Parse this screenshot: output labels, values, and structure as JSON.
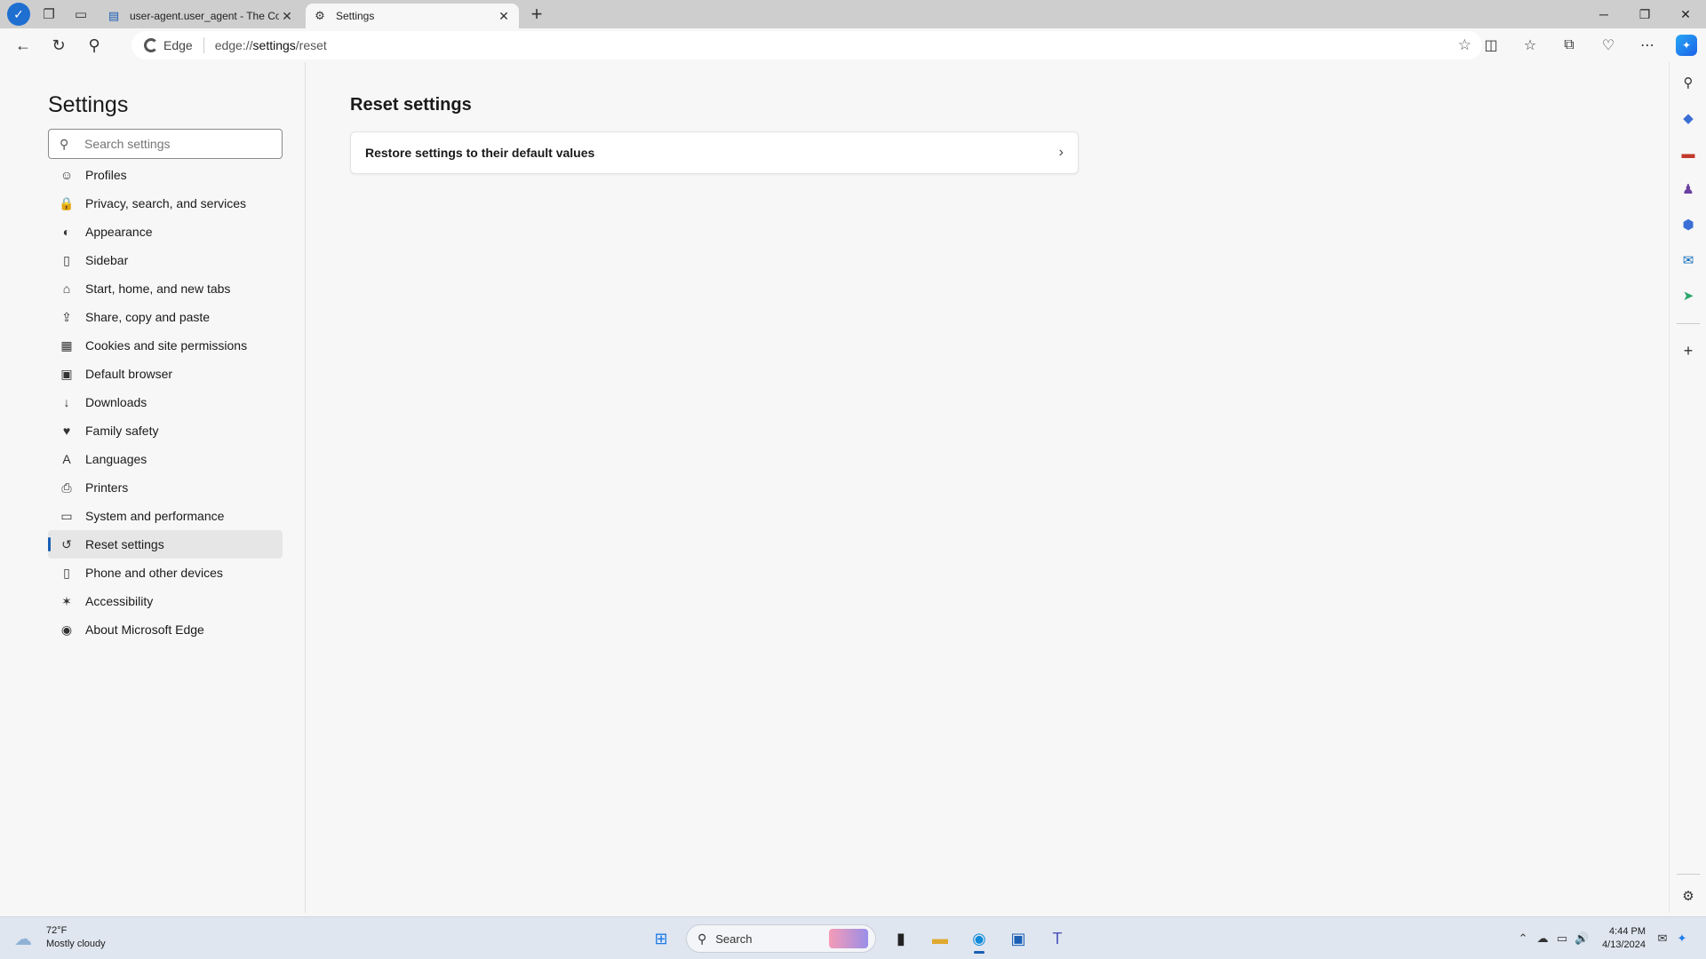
{
  "browser": {
    "tabs": [
      {
        "title": "user-agent.user_agent - The Coll",
        "active": false
      },
      {
        "title": "Settings",
        "active": true
      }
    ],
    "edge_chip": "Edge",
    "url_prefix": "edge://",
    "url_path": "settings",
    "url_suffix": "/reset"
  },
  "settings": {
    "title": "Settings",
    "search_placeholder": "Search settings",
    "nav": [
      {
        "label": "Profiles",
        "icon": "profile-icon",
        "glyph": "☺"
      },
      {
        "label": "Privacy, search, and services",
        "icon": "lock-icon",
        "glyph": "🔒"
      },
      {
        "label": "Appearance",
        "icon": "appearance-icon",
        "glyph": "◐"
      },
      {
        "label": "Sidebar",
        "icon": "sidebar-icon",
        "glyph": "▯"
      },
      {
        "label": "Start, home, and new tabs",
        "icon": "home-icon",
        "glyph": "⌂"
      },
      {
        "label": "Share, copy and paste",
        "icon": "share-icon",
        "glyph": "⇪"
      },
      {
        "label": "Cookies and site permissions",
        "icon": "cookies-icon",
        "glyph": "▦"
      },
      {
        "label": "Default browser",
        "icon": "default-browser-icon",
        "glyph": "▣"
      },
      {
        "label": "Downloads",
        "icon": "download-icon",
        "glyph": "↓"
      },
      {
        "label": "Family safety",
        "icon": "family-icon",
        "glyph": "♥"
      },
      {
        "label": "Languages",
        "icon": "languages-icon",
        "glyph": "A"
      },
      {
        "label": "Printers",
        "icon": "printer-icon",
        "glyph": "⎙"
      },
      {
        "label": "System and performance",
        "icon": "system-icon",
        "glyph": "▭"
      },
      {
        "label": "Reset settings",
        "icon": "reset-icon",
        "glyph": "↺",
        "active": true
      },
      {
        "label": "Phone and other devices",
        "icon": "phone-icon",
        "glyph": "▯"
      },
      {
        "label": "Accessibility",
        "icon": "accessibility-icon",
        "glyph": "✶"
      },
      {
        "label": "About Microsoft Edge",
        "icon": "edge-logo-icon",
        "glyph": "◉"
      }
    ]
  },
  "main": {
    "page_title": "Reset settings",
    "restore_label": "Restore settings to their default values"
  },
  "taskbar": {
    "weather_temp": "72°F",
    "weather_desc": "Mostly cloudy",
    "search_label": "Search",
    "clock_time": "4:44 PM",
    "clock_date": "4/13/2024"
  },
  "colors": {
    "accent": "#1a5fb4",
    "active_nav_bg": "#e6e6e6"
  }
}
